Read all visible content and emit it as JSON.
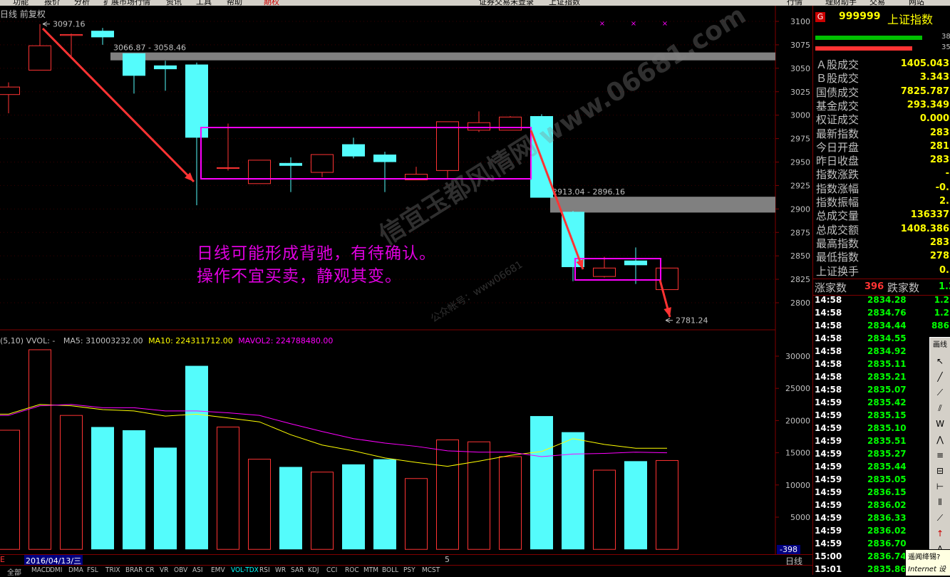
{
  "menu": [
    "功能",
    "报价",
    "分析",
    "扩展市场行情",
    "资讯",
    "工具",
    "帮助",
    "期权",
    "证券交易未登录",
    "上证指数",
    "行情",
    "理财助手",
    "交易",
    "网站"
  ],
  "chart_header": "日线 前复权",
  "chart_data": {
    "type": "candlestick",
    "y_ticks": [
      3100,
      3075,
      3050,
      3025,
      3000,
      2975,
      2950,
      2925,
      2900,
      2875,
      2850,
      2825,
      2800
    ],
    "candles": [
      {
        "o": 3022,
        "h": 3035,
        "l": 3002,
        "c": 3030
      },
      {
        "o": 3048,
        "h": 3097.16,
        "l": 3048,
        "c": 3074
      },
      {
        "o": 3085,
        "h": 3087,
        "l": 3060,
        "c": 3086
      },
      {
        "o": 3090,
        "h": 3093,
        "l": 3075,
        "c": 3083
      },
      {
        "o": 3066,
        "h": 3066,
        "l": 3023,
        "c": 3042
      },
      {
        "o": 3053,
        "h": 3058,
        "l": 3026,
        "c": 3049
      },
      {
        "o": 3054,
        "h": 3056,
        "l": 2904,
        "c": 2976
      },
      {
        "o": 2944,
        "h": 2991,
        "l": 2941,
        "c": 2944
      },
      {
        "o": 2927,
        "h": 2952,
        "l": 2927,
        "c": 2952
      },
      {
        "o": 2949,
        "h": 2955,
        "l": 2918,
        "c": 2946
      },
      {
        "o": 2939,
        "h": 2958,
        "l": 2934,
        "c": 2958
      },
      {
        "o": 2969,
        "h": 2976,
        "l": 2954,
        "c": 2956
      },
      {
        "o": 2958,
        "h": 2961,
        "l": 2918,
        "c": 2950
      },
      {
        "o": 2931,
        "h": 2945,
        "l": 2931,
        "c": 2937
      },
      {
        "o": 2941,
        "h": 2993,
        "l": 2933,
        "c": 2993
      },
      {
        "o": 2984,
        "h": 3004,
        "l": 2982,
        "c": 2992
      },
      {
        "o": 2984,
        "h": 2999,
        "l": 2984,
        "c": 2998
      },
      {
        "o": 2999,
        "h": 3001,
        "l": 2912,
        "c": 2912
      },
      {
        "o": 2897,
        "h": 2898,
        "l": 2823,
        "c": 2838
      },
      {
        "o": 2828,
        "h": 2849,
        "l": 2827,
        "c": 2837
      },
      {
        "o": 2845,
        "h": 2859,
        "l": 2820,
        "c": 2840
      },
      {
        "o": 2814,
        "h": 2837,
        "l": 2814,
        "c": 2837
      }
    ],
    "volume_y_ticks": [
      30000,
      25000,
      20000,
      15000,
      10000,
      5000
    ],
    "volumes": [
      18500,
      31000,
      20800,
      19000,
      18500,
      15800,
      28500,
      19000,
      14000,
      12800,
      12000,
      13200,
      14000,
      11000,
      17000,
      16700,
      14400,
      20700,
      18200,
      12300,
      13700,
      13800
    ],
    "ma5": [
      21000,
      22500,
      22300,
      21700,
      21500,
      20700,
      21000,
      20400,
      19800,
      17800,
      16200,
      15300,
      14200,
      13500,
      12900,
      13700,
      14600,
      15200,
      17200,
      16300,
      15700,
      15700
    ],
    "ma10": [
      20800,
      22300,
      22500,
      22000,
      22000,
      21500,
      21500,
      21200,
      20800,
      19500,
      18300,
      17200,
      16500,
      16000,
      15300,
      15100,
      15100,
      14400,
      14800,
      14900,
      15100,
      15000
    ],
    "gaps": [
      "3066.87 - 3058.46",
      "2913.04 - 2896.16"
    ],
    "labels": {
      "high": "3097.16",
      "low": "2781.24"
    },
    "volume_header": {
      "prefix": "(5,10) VVOL: -",
      "ma5": "MA5: 310003232.00",
      "ma10": "MA10: 224311712.00",
      "mavol2": "MAVOL2: 224788480.00"
    },
    "colors": {
      "up": "#ff3333",
      "down": "#54fcfc",
      "ma5": "#ffff00",
      "ma10": "#ff00ff",
      "gap": "#808080",
      "box": "#ff00ff",
      "arrow": "#ff3333"
    }
  },
  "annotation": {
    "line1": "日线可能形成背驰，有待确认。",
    "line2": "操作不宜买卖，静观其变。"
  },
  "watermark": {
    "line1": "信宜玉都风情网 www.06681.com",
    "line2": "公众帐号：www06681"
  },
  "date_label": "2016/04/13/三",
  "date_mark": "5",
  "period_label": "日线",
  "vol_readout": "-398",
  "panel": {
    "code": "999999",
    "name": "上证指数",
    "bar_nums": [
      "38",
      "35"
    ],
    "rows": [
      {
        "label": "Ａ股成交",
        "value": "1405.043"
      },
      {
        "label": "Ｂ股成交",
        "value": "3.343"
      },
      {
        "label": "国债成交",
        "value": "7825.787"
      },
      {
        "label": "基金成交",
        "value": "293.349"
      },
      {
        "label": "权证成交",
        "value": "0.000"
      },
      {
        "label": "最新指数",
        "value": "283"
      },
      {
        "label": "今日开盘",
        "value": "281"
      },
      {
        "label": "昨日收盘",
        "value": "283"
      },
      {
        "label": "指数涨跌",
        "value": "-"
      },
      {
        "label": "指数涨幅",
        "value": "-0."
      },
      {
        "label": "指数振幅",
        "value": "2."
      },
      {
        "label": "总成交量",
        "value": "136337"
      },
      {
        "label": "总成交额",
        "value": "1408.386"
      },
      {
        "label": "最高指数",
        "value": "283"
      },
      {
        "label": "最低指数",
        "value": "278"
      },
      {
        "label": "上证换手",
        "value": "0."
      }
    ],
    "updown": {
      "up_label": "涨家数",
      "up": "396",
      "down_label": "跌家数",
      "down": "1.2"
    },
    "ticks": [
      {
        "t": "14:58",
        "p": "2834.28",
        "x": "1.2"
      },
      {
        "t": "14:58",
        "p": "2834.76",
        "x": "1.2"
      },
      {
        "t": "14:58",
        "p": "2834.44",
        "x": "886"
      },
      {
        "t": "14:58",
        "p": "2834.55",
        "x": ""
      },
      {
        "t": "14:58",
        "p": "2834.92",
        "x": ""
      },
      {
        "t": "14:58",
        "p": "2835.11",
        "x": ""
      },
      {
        "t": "14:58",
        "p": "2835.21",
        "x": ""
      },
      {
        "t": "14:58",
        "p": "2835.07",
        "x": ""
      },
      {
        "t": "14:59",
        "p": "2835.42",
        "x": ""
      },
      {
        "t": "14:59",
        "p": "2835.15",
        "x": ""
      },
      {
        "t": "14:59",
        "p": "2835.10",
        "x": ""
      },
      {
        "t": "14:59",
        "p": "2835.51",
        "x": ""
      },
      {
        "t": "14:59",
        "p": "2835.27",
        "x": ""
      },
      {
        "t": "14:59",
        "p": "2835.44",
        "x": ""
      },
      {
        "t": "14:59",
        "p": "2835.05",
        "x": ""
      },
      {
        "t": "14:59",
        "p": "2836.15",
        "x": ""
      },
      {
        "t": "14:59",
        "p": "2836.02",
        "x": ""
      },
      {
        "t": "14:59",
        "p": "2836.33",
        "x": ""
      },
      {
        "t": "14:59",
        "p": "2836.02",
        "x": ""
      },
      {
        "t": "14:59",
        "p": "2836.70",
        "x": ""
      },
      {
        "t": "15:00",
        "p": "2836.74",
        "x": ""
      },
      {
        "t": "15:01",
        "p": "2835.86",
        "x": ""
      }
    ]
  },
  "toolbar": {
    "title": "画线"
  },
  "tooltip": {
    "line1": "遥闻绛锡?",
    "line2": "Internet 设"
  },
  "tabs": [
    "全部",
    "MACD",
    "DMI",
    "DMA",
    "FSL",
    "TRIX",
    "BRAR",
    "CR",
    "VR",
    "OBV",
    "ASI",
    "EMV",
    "VOL-TDX",
    "RSI",
    "WR",
    "SAR",
    "KDJ",
    "CCI",
    "ROC",
    "MTM",
    "BOLL",
    "PSY",
    "MCST"
  ]
}
